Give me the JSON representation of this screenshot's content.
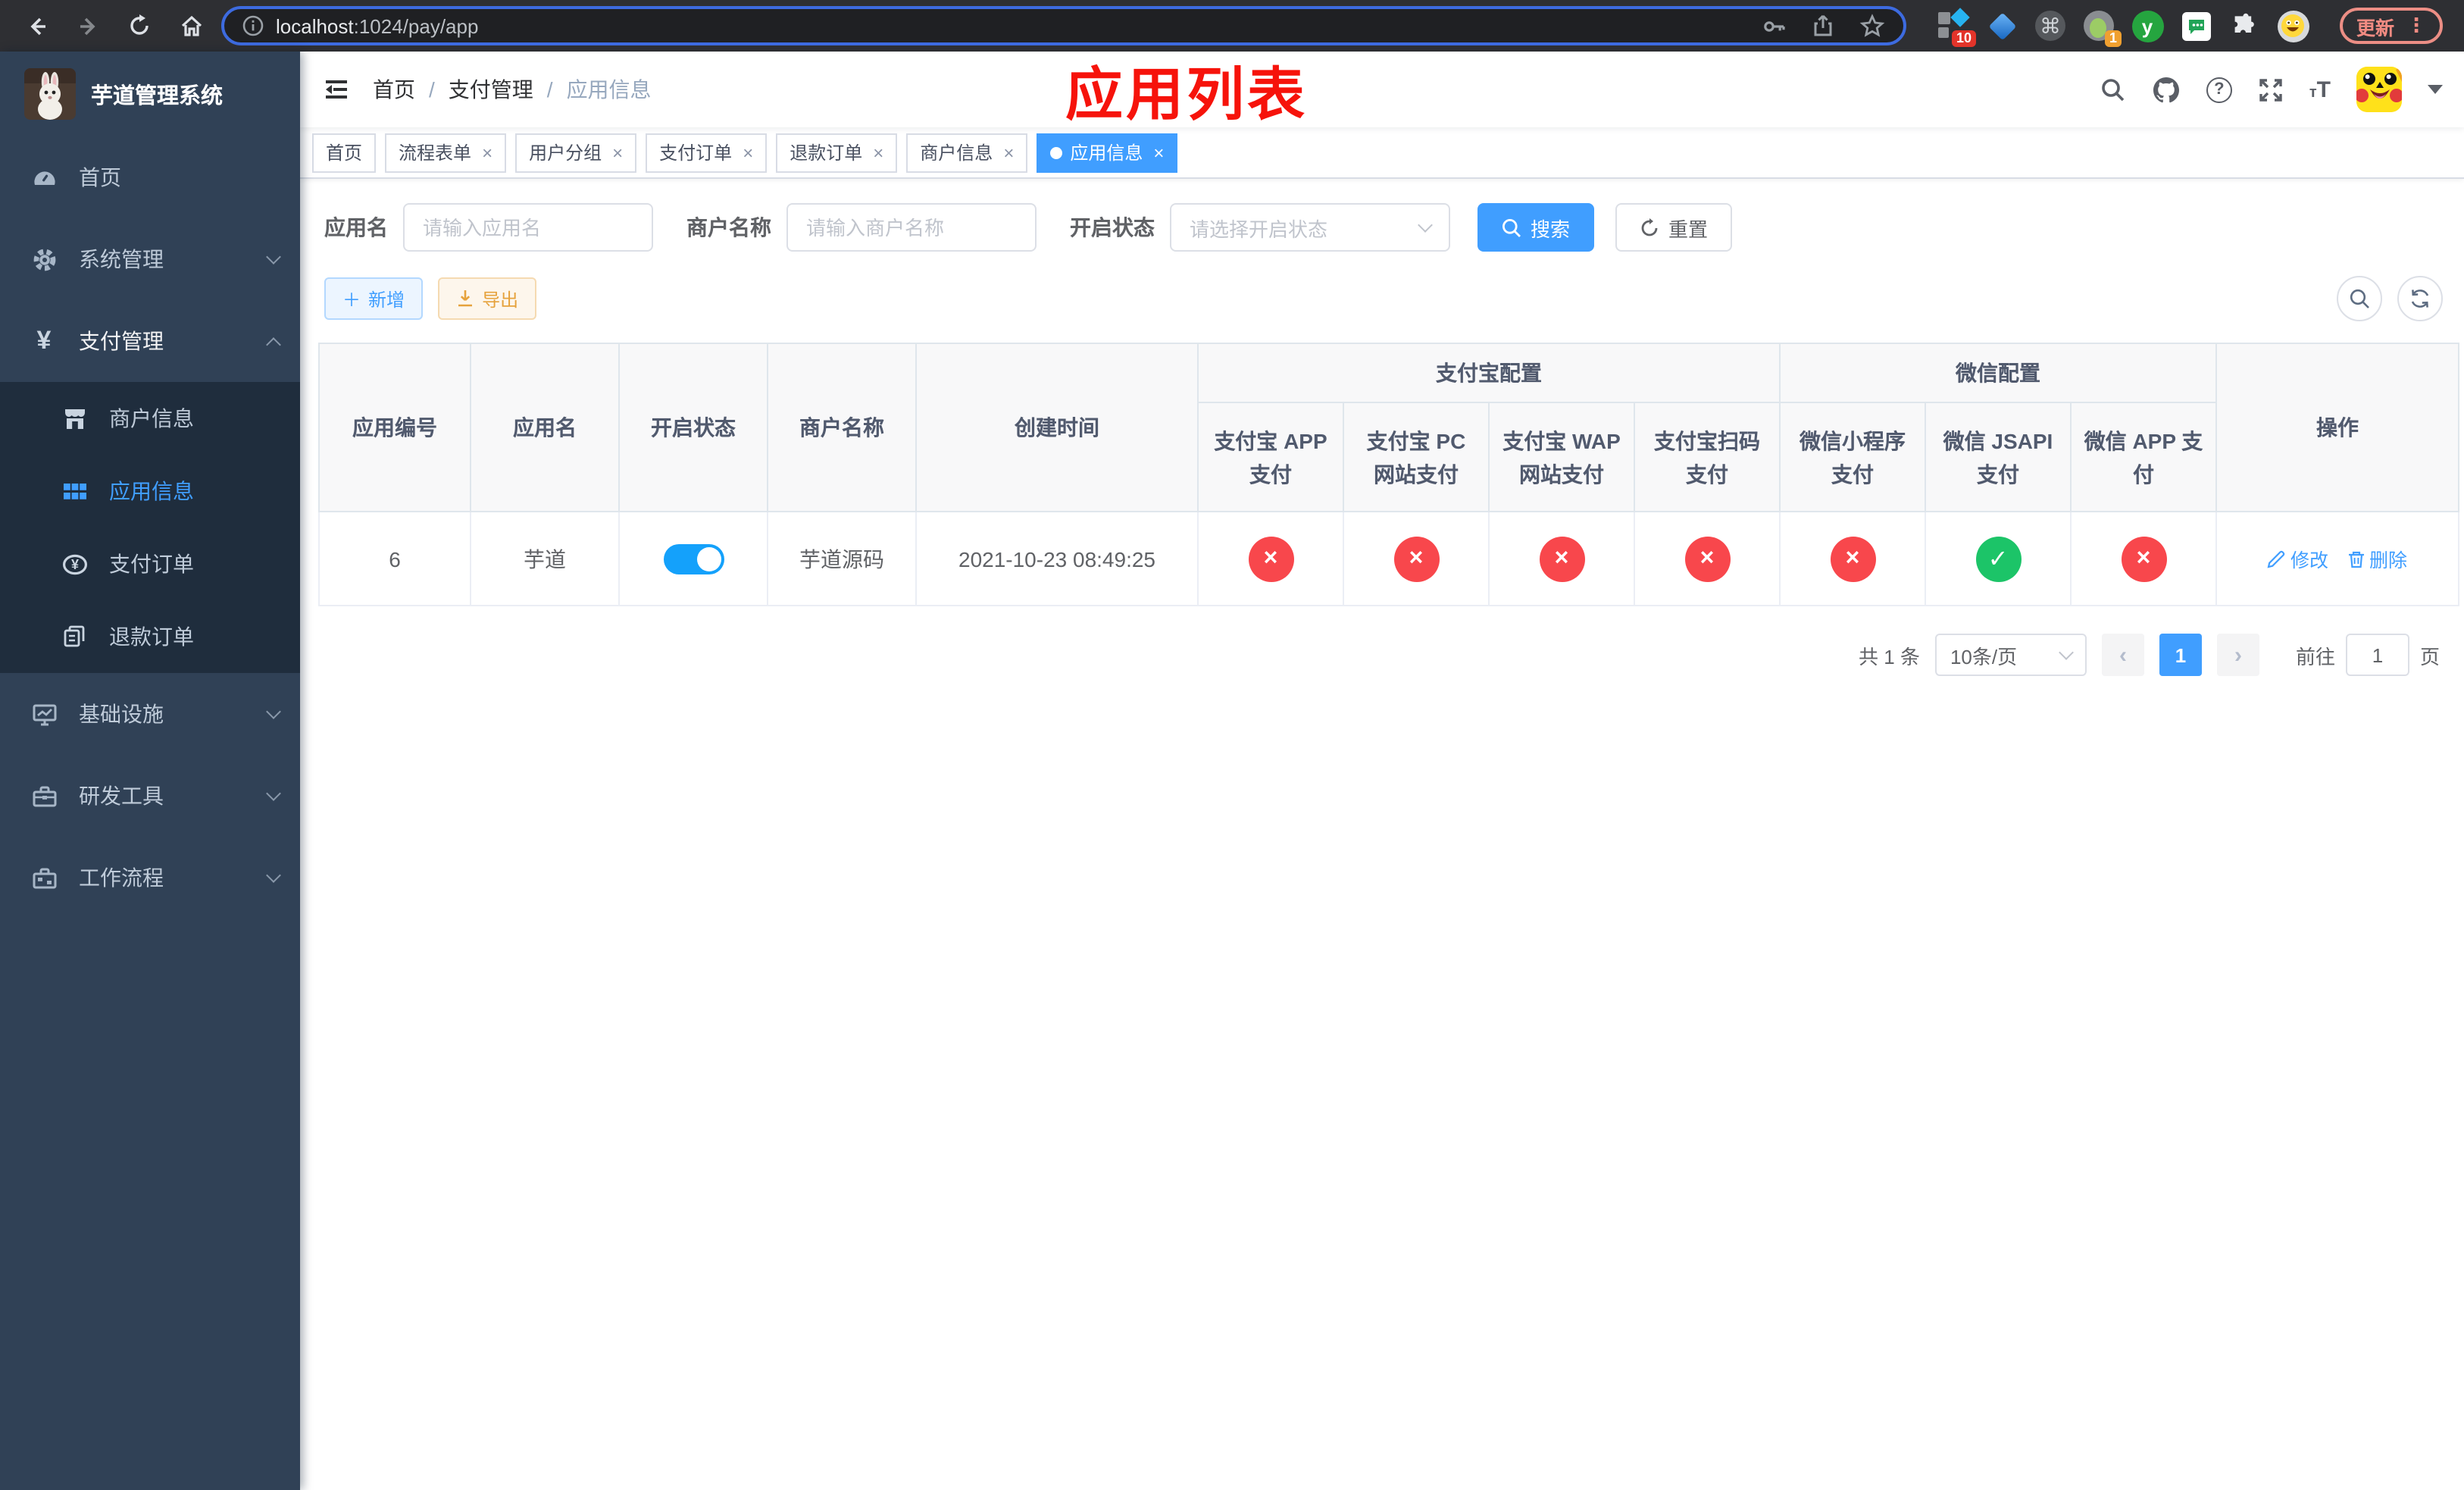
{
  "browser": {
    "url_host": "localhost",
    "url_path": ":1024/pay/app",
    "update_label": "更新",
    "kebab": "⋮",
    "ext_badge_monkey": "10",
    "ext_badge_avatar": "1",
    "ext_letter": "y"
  },
  "sidebar": {
    "title": "芋道管理系统",
    "menu": [
      {
        "label": "首页"
      },
      {
        "label": "系统管理"
      },
      {
        "label": "支付管理"
      },
      {
        "label": "基础设施"
      },
      {
        "label": "研发工具"
      },
      {
        "label": "工作流程"
      }
    ],
    "submenu": [
      {
        "label": "商户信息"
      },
      {
        "label": "应用信息"
      },
      {
        "label": "支付订单"
      },
      {
        "label": "退款订单"
      }
    ]
  },
  "breadcrumb": [
    "首页",
    "支付管理",
    "应用信息"
  ],
  "annotation": {
    "text": "应用列表",
    "color": "#f6130b"
  },
  "tabs": [
    {
      "label": "首页",
      "closable": false,
      "active": false
    },
    {
      "label": "流程表单",
      "closable": true,
      "active": false
    },
    {
      "label": "用户分组",
      "closable": true,
      "active": false
    },
    {
      "label": "支付订单",
      "closable": true,
      "active": false
    },
    {
      "label": "退款订单",
      "closable": true,
      "active": false
    },
    {
      "label": "商户信息",
      "closable": true,
      "active": false
    },
    {
      "label": "应用信息",
      "closable": true,
      "active": true
    }
  ],
  "filters": {
    "app_name_label": "应用名",
    "app_name_placeholder": "请输入应用名",
    "merchant_label": "商户名称",
    "merchant_placeholder": "请输入商户名称",
    "status_label": "开启状态",
    "status_placeholder": "请选择开启状态",
    "search_label": "搜索",
    "reset_label": "重置"
  },
  "toolbar": {
    "add_label": "新增",
    "export_label": "导出"
  },
  "table": {
    "columns": [
      "应用编号",
      "应用名",
      "开启状态",
      "商户名称",
      "创建时间"
    ],
    "alipay_group": "支付宝配置",
    "wechat_group": "微信配置",
    "alipay_columns": [
      "支付宝 APP 支付",
      "支付宝 PC 网站支付",
      "支付宝 WAP 网站支付",
      "支付宝扫码支付"
    ],
    "wechat_columns": [
      "微信小程序支付",
      "微信 JSAPI 支付",
      "微信 APP 支付"
    ],
    "actions_column": "操作",
    "row": {
      "id": "6",
      "app_name": "芋道",
      "enabled": true,
      "merchant_name": "芋道源码",
      "created_at": "2021-10-23 08:49:25",
      "pay_status": [
        false,
        false,
        false,
        false,
        false,
        true,
        false
      ],
      "edit_label": "修改",
      "delete_label": "删除"
    }
  },
  "pagination": {
    "total": "共 1 条",
    "page_size": "10条/页",
    "prev": "‹",
    "next": "›",
    "page": "1",
    "goto_label": "前往",
    "goto_value": "1",
    "unit_label": "页"
  },
  "colors": {
    "accent": "#409eff",
    "sidebar_bg": "#304156",
    "submenu_bg": "#1f2d3d",
    "danger_circle": "#f8474c",
    "success_circle": "#1cc468",
    "toggle_on": "#14a1fb",
    "annotation_red": "#f6130b",
    "export_orange": "#e6a23c"
  }
}
